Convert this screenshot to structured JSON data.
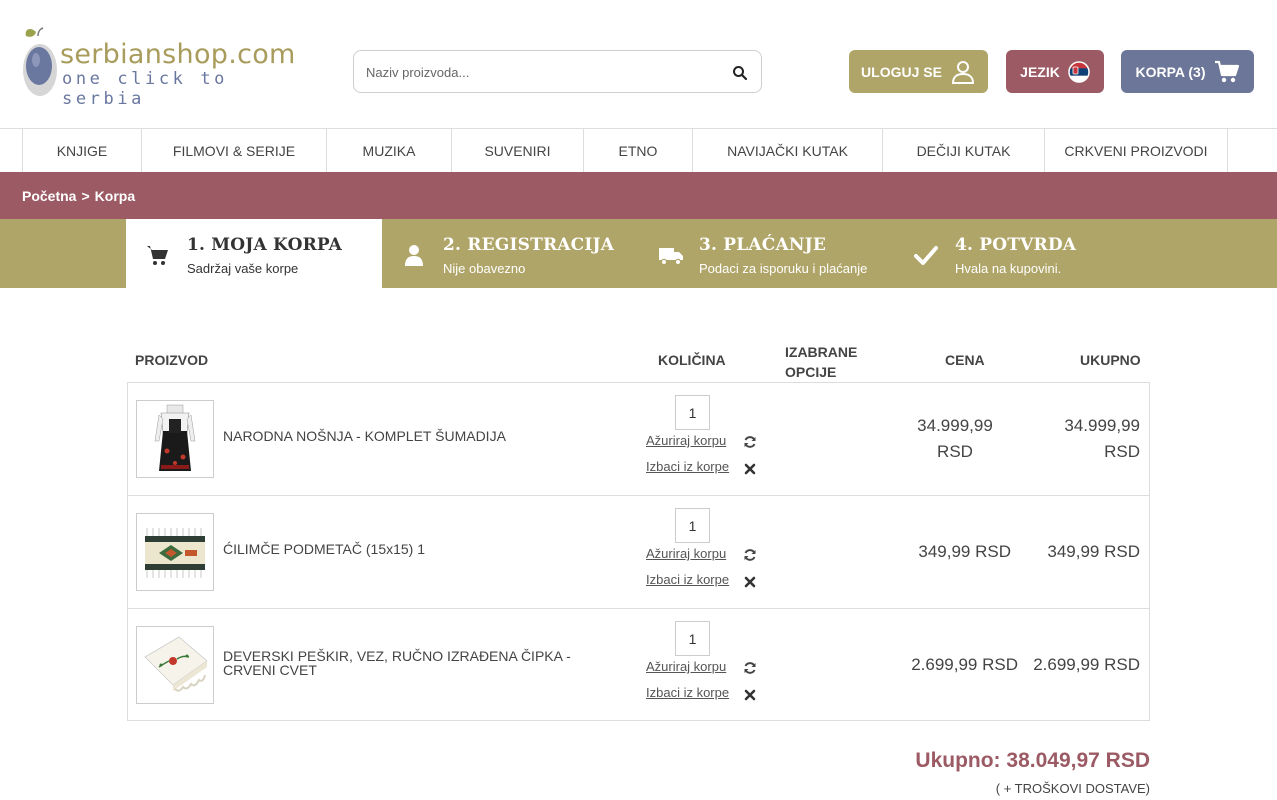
{
  "header": {
    "logo_title": "serbianshop.com",
    "logo_sub": "one click to serbia",
    "search_placeholder": "Naziv proizvoda...",
    "login_label": "ULOGUJ SE",
    "lang_label": "JEZIK",
    "cart_label": "KORPA",
    "cart_count": "(3)"
  },
  "nav": [
    "KNJIGE",
    "FILMOVI & SERIJE",
    "MUZIKA",
    "SUVENIRI",
    "ETNO",
    "NAVIJAČKI KUTAK",
    "DEČIJI KUTAK",
    "CRKVENI PROIZVODI"
  ],
  "breadcrumb": {
    "home": "Početna",
    "sep": ">",
    "current": "Korpa"
  },
  "steps": [
    {
      "title": "1. MOJA KORPA",
      "sub": "Sadržaj vaše korpe"
    },
    {
      "title": "2. REGISTRACIJA",
      "sub": "Nije obavezno"
    },
    {
      "title": "3. PLAĆANJE",
      "sub": "Podaci za isporuku i plaćanje"
    },
    {
      "title": "4. POTVRDA",
      "sub": "Hvala na kupovini."
    }
  ],
  "table": {
    "col_product": "PROIZVOD",
    "col_qty": "KOLIČINA",
    "col_options_1": "IZABRANE",
    "col_options_2": "OPCIJE",
    "col_price": "CENA",
    "col_total": "UKUPNO",
    "update_label": "Ažuriraj korpu",
    "remove_label": "Izbaci iz korpe"
  },
  "items": [
    {
      "name": "NARODNA NOŠNJA - KOMPLET ŠUMADIJA",
      "qty": "1",
      "price_1": "34.999,99",
      "price_2": "RSD",
      "total_1": "34.999,99",
      "total_2": "RSD"
    },
    {
      "name": "ĆILIMČE PODMETAČ (15x15) 1",
      "qty": "1",
      "price": "349,99 RSD",
      "total": "349,99 RSD"
    },
    {
      "name_1": "DEVERSKI PEŠKIR, VEZ, RUČNO IZRAĐENA ČIPKA -",
      "name_2": "CRVENI CVET",
      "qty": "1",
      "price": "2.699,99 RSD",
      "total": "2.699,99 RSD"
    }
  ],
  "summary": {
    "total_label": "Ukupno: 38.049,97 RSD",
    "shipping_note": "( + TROŠKOVI DOSTAVE)"
  },
  "colors": {
    "olive": "#b0a568",
    "burgundy": "#9b5a64",
    "slate": "#6b7698"
  }
}
